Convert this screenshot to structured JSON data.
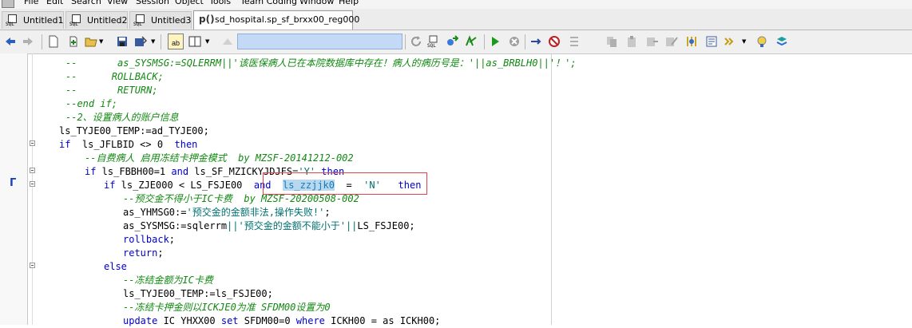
{
  "menubar": {
    "items": [
      "File",
      "Edit",
      "Search",
      "View",
      "Session",
      "Object",
      "Tools",
      "Team Coding",
      "Window",
      "Help"
    ]
  },
  "tabs": [
    {
      "label": "Untitled1",
      "icon": "sql-file-icon"
    },
    {
      "label": "Untitled2",
      "icon": "sql-file-icon"
    },
    {
      "label": "Untitled3",
      "icon": "sql-file-icon"
    },
    {
      "label": "sd_hospital.sp_sf_brxx00_reg000",
      "icon": "procedure-icon",
      "prefix": "p()"
    }
  ],
  "editor": {
    "lines": [
      [
        [
          "cm",
          "--       as_SYSMSG:=SQLERRM||'该医保病人已在本院数据库中存在！病人的病历号是：'||as_BRBLH0||'！';"
        ]
      ],
      [
        [
          "cm",
          "--      ROLLBACK;"
        ]
      ],
      [
        [
          "cm",
          "--       RETURN;"
        ]
      ],
      [
        [
          "cm",
          "--end if;"
        ]
      ],
      [
        [
          "cm",
          "--2、设置病人的账户信息"
        ]
      ],
      [
        [
          "tx",
          "ls_TYJE00_TEMP:=ad_TYJE00;"
        ]
      ],
      [
        [
          "kw",
          "if"
        ],
        [
          "tx",
          "  ls_JFLBID <> 0  "
        ],
        [
          "kw",
          "then"
        ]
      ],
      [
        [
          "cm",
          "--自费病人 启用冻结卡押金模式  by MZSF-20141212-002"
        ]
      ],
      [
        [
          "kw",
          "if"
        ],
        [
          "tx",
          " ls_FBBH00=1 "
        ],
        [
          "kw",
          "and"
        ],
        [
          "tx",
          " ls_SF_MZICKYJDJFS="
        ],
        [
          "st",
          "'Y'"
        ],
        [
          "tx",
          " "
        ],
        [
          "kw",
          "then"
        ]
      ],
      [
        [
          "kw",
          "if"
        ],
        [
          "tx",
          " ls_ZJE000 < LS_FSJE00  "
        ],
        [
          "kw",
          "and"
        ],
        [
          "tx",
          "  "
        ],
        [
          "hl",
          "ls_zzjjk0"
        ],
        [
          "tx",
          "  =  "
        ],
        [
          "st",
          "'N'"
        ],
        [
          "tx",
          "   "
        ],
        [
          "kw",
          "then"
        ]
      ],
      [
        [
          "cm",
          "--预交金不得小于IC卡费  by MZSF-20200508-002"
        ]
      ],
      [
        [
          "tx",
          "as_YHMSG0:="
        ],
        [
          "st",
          "'预交金的金额非法,操作失败!'"
        ],
        [
          "tx",
          ";"
        ]
      ],
      [
        [
          "tx",
          "as_SYSMSG:=sqlerrm"
        ],
        [
          "st",
          "||"
        ],
        [
          "st",
          "'预交金的金额不能小于'"
        ],
        [
          "st",
          "||"
        ],
        [
          "tx",
          "LS_FSJE00;"
        ]
      ],
      [
        [
          "kw",
          "rollback"
        ],
        [
          "tx",
          ";"
        ]
      ],
      [
        [
          "kw",
          "return"
        ],
        [
          "tx",
          ";"
        ]
      ],
      [
        [
          "kw",
          "else"
        ]
      ],
      [
        [
          "cm",
          "--冻结金额为IC卡费"
        ]
      ],
      [
        [
          "tx",
          "ls_TYJE00_TEMP:=ls_FSJE00;"
        ]
      ],
      [
        [
          "cm",
          "--冻结卡押金则以ICKJE0为准 SFDM00设置为0"
        ]
      ],
      [
        [
          "kw",
          "update"
        ],
        [
          "tx",
          " IC YHXX00 "
        ],
        [
          "kw",
          "set"
        ],
        [
          "tx",
          " SFDM00=0 "
        ],
        [
          "kw",
          "where"
        ],
        [
          "tx",
          " ICKH00 = as ICKH00;"
        ]
      ]
    ]
  },
  "colors": {
    "comment": "#118811",
    "keyword": "#0000cc",
    "string": "#007070",
    "highlight_box": "#e04848",
    "selection": "#b8d8f0"
  }
}
